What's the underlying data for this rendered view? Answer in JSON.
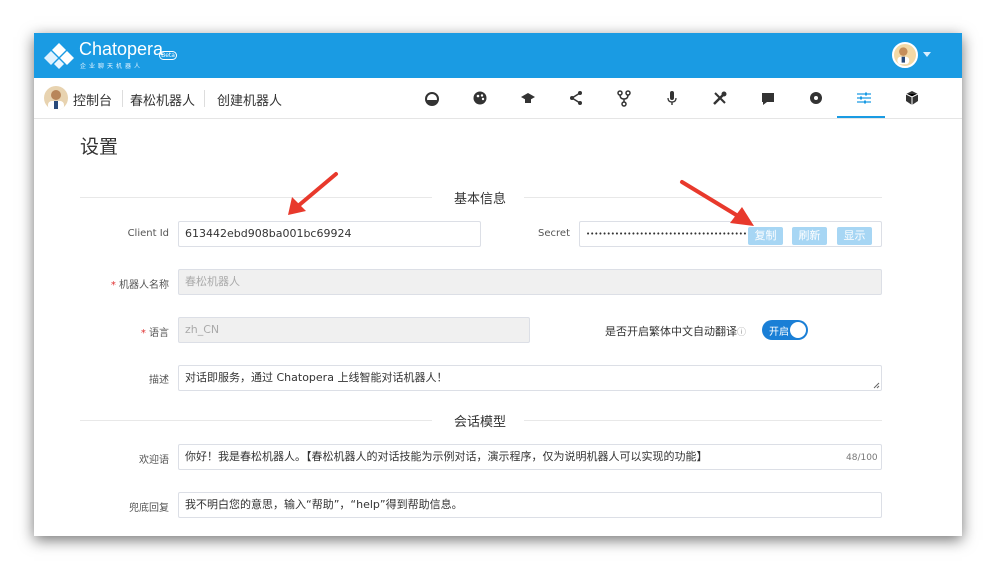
{
  "header": {
    "brand": "Chatopera",
    "brand_sub": "企业聊天机器人",
    "beta": "Beta"
  },
  "breadcrumb": {
    "console": "控制台",
    "bot_name": "春松机器人",
    "create": "创建机器人"
  },
  "nav_icons": [
    "dashboard-icon",
    "palette-icon",
    "graduation-cap-icon",
    "share-icon",
    "fork-icon",
    "microphone-icon",
    "tools-icon",
    "chat-icon",
    "settings-circle-icon",
    "sliders-icon",
    "cube-icon"
  ],
  "page": {
    "title": "设置"
  },
  "basic": {
    "section_title": "基本信息",
    "client_id_label": "Client Id",
    "client_id_value": "613442ebd908ba001bc69924",
    "secret_label": "Secret",
    "secret_value": "••••••••••••••••••••••••••••••••••••••••",
    "copy_btn": "复制",
    "refresh_btn": "刷新",
    "show_btn": "显示",
    "required_mark": "*",
    "bot_name_label": "机器人名称",
    "bot_name_placeholder": "春松机器人",
    "lang_label": "语言",
    "lang_value": "zh_CN",
    "trad_label": "是否开启繁体中文自动翻译",
    "info_mark": "ⓘ",
    "trad_toggle": "开启",
    "desc_label": "描述",
    "desc_value": "对话即服务，通过 Chatopera 上线智能对话机器人！"
  },
  "session": {
    "section_title": "会话模型",
    "welcome_label": "欢迎语",
    "welcome_value": "你好！我是春松机器人。【春松机器人的对话技能为示例对话，演示程序，仅为说明机器人可以实现的功能】",
    "welcome_count": "48/100",
    "fallback_label": "兜底回复",
    "fallback_value": "我不明白您的意思，输入“帮助”，“help”得到帮助信息。"
  },
  "colors": {
    "accent": "#1a9be3",
    "arrow": "#e8392c",
    "required": "#e03030"
  }
}
